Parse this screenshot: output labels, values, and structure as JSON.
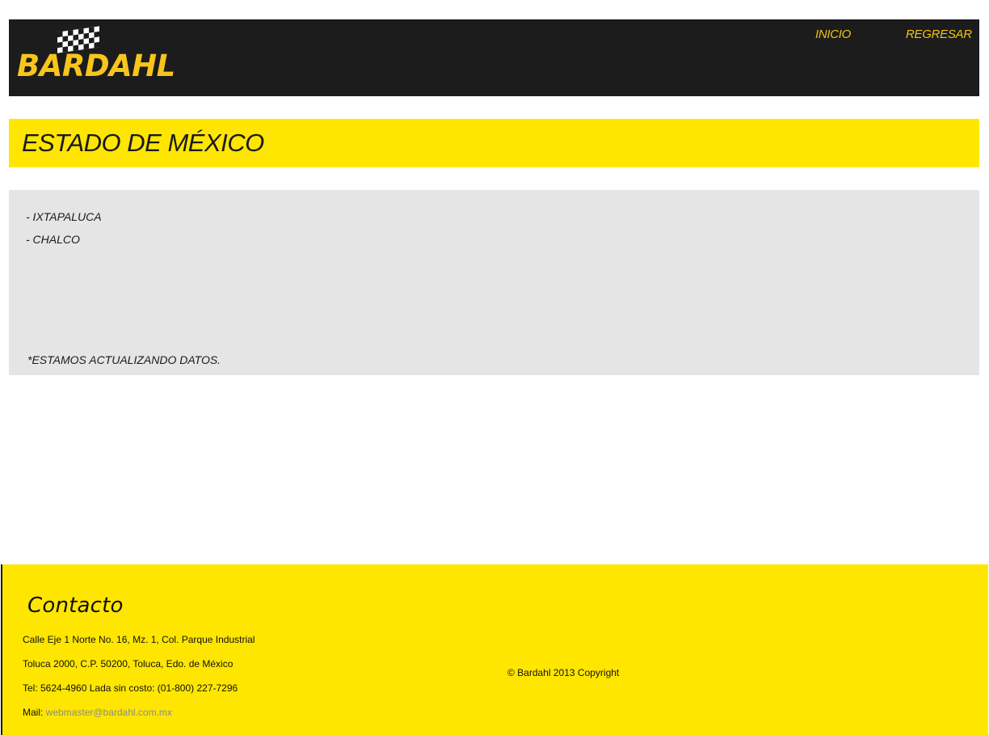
{
  "brand": {
    "name": "BARDAHL",
    "brand_color": "#f7c51c",
    "accent_yellow": "#ffe600"
  },
  "nav": {
    "inicio": "INICIO",
    "regresar": "REGRESAR"
  },
  "page": {
    "title": "ESTADO DE MÉXICO"
  },
  "locations": [
    "- IXTAPALUCA",
    "- CHALCO"
  ],
  "note": "*ESTAMOS ACTUALIZANDO DATOS.",
  "footer": {
    "heading": "Contacto",
    "address_line1": "Calle Eje 1 Norte No. 16, Mz. 1, Col. Parque Industrial",
    "address_line2": "Toluca 2000, C.P. 50200, Toluca, Edo. de México",
    "phone": "Tel: 5624-4960  Lada sin costo: (01-800) 227-7296",
    "mail_label": "Mail: ",
    "mail_address": "webmaster@bardahl.com.mx",
    "copyright": "© Bardahl 2013 Copyright"
  }
}
